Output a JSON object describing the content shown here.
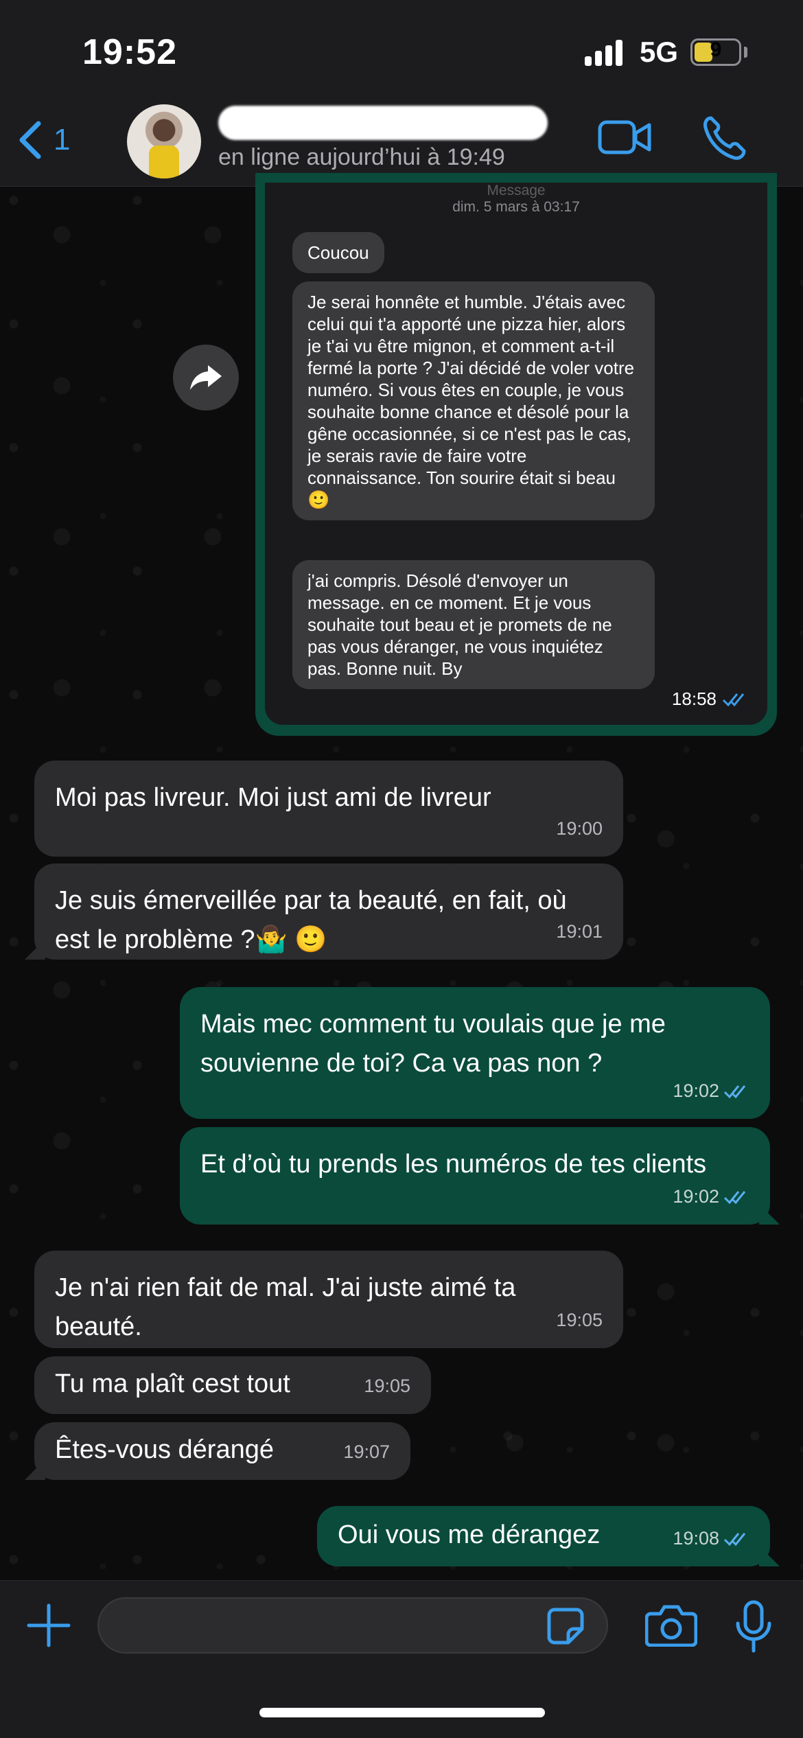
{
  "status_bar": {
    "time": "19:52",
    "network": "5G",
    "battery": "9"
  },
  "header": {
    "back_count": "1",
    "presence": "en ligne aujourd’hui à 19:49"
  },
  "forwarded_screenshot": {
    "header_label": "Message",
    "date": "dim. 5 mars à 03:17",
    "messages": [
      "Coucou",
      "Je serai honnête et humble. J'étais avec celui qui t'a apporté une pizza hier, alors je t'ai vu être mignon, et comment a-t-il fermé la porte ? J'ai décidé de voler votre numéro. Si vous êtes en couple, je vous souhaite bonne chance et désolé pour la gêne occasionnée, si ce n'est pas le cas, je serais ravie de faire votre connaissance. Ton sourire était si beau 🙂",
      "j'ai compris. Désolé d'envoyer un message. en ce moment. Et je vous souhaite tout beau et je promets de ne pas vous déranger, ne vous inquiétez pas. Bonne nuit. By"
    ],
    "time": "18:58"
  },
  "messages": [
    {
      "text": "Moi pas livreur. Moi just ami de livreur",
      "time": "19:00"
    },
    {
      "text": "Je suis émerveillée par ta beauté, en fait, où est le problème ?🤷‍♂️ 🙂",
      "time": "19:01"
    },
    {
      "text": "Mais mec comment tu voulais que je me souvienne de toi? Ca va pas non ?",
      "time": "19:02"
    },
    {
      "text": "Et d’où tu prends les numéros de tes clients",
      "time": "19:02"
    },
    {
      "text": "Je n'ai rien fait de mal. J'ai juste aimé ta beauté.",
      "time": "19:05"
    },
    {
      "text": "Tu ma plaît cest tout",
      "time": "19:05"
    },
    {
      "text": "Êtes-vous dérangé",
      "time": "19:07"
    },
    {
      "text": "Oui vous me dérangez",
      "time": "19:08"
    }
  ],
  "colors": {
    "accent": "#3a9dec",
    "outgoing_bubble": "#0a4b3c",
    "incoming_bubble": "#2c2c2e"
  },
  "icons": [
    "back-chevron-icon",
    "video-call-icon",
    "phone-call-icon",
    "forward-icon",
    "read-ticks-icon",
    "plus-icon",
    "sticker-icon",
    "camera-icon",
    "microphone-icon"
  ]
}
